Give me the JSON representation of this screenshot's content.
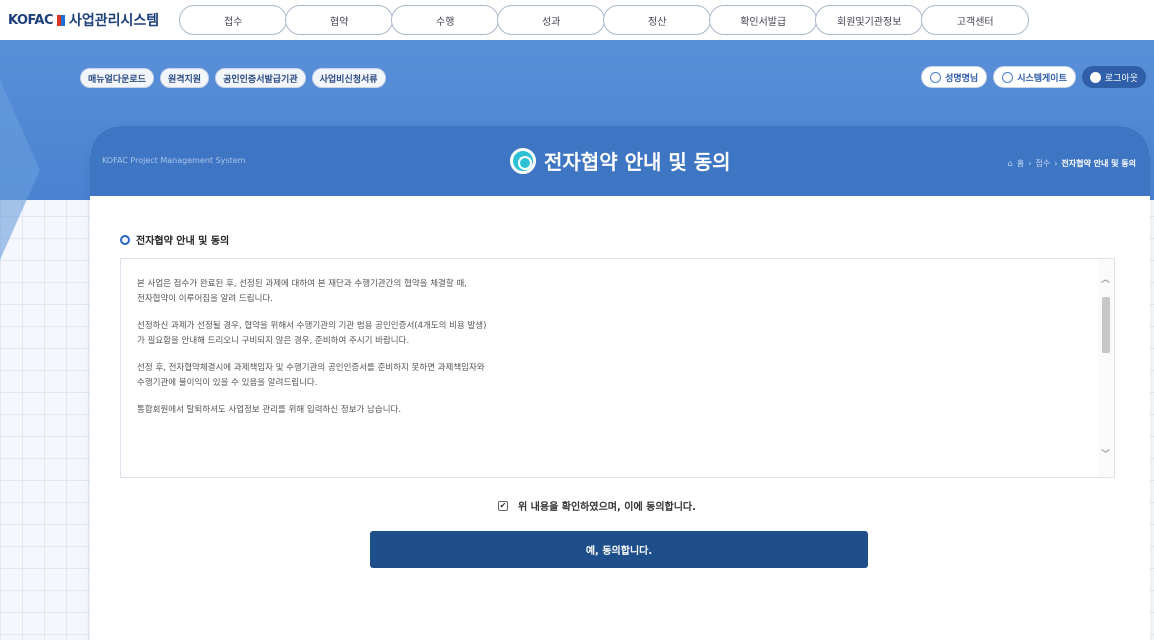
{
  "brand": {
    "logo_text": "KOFAC",
    "system_name": "사업관리시스템"
  },
  "main_menu": [
    {
      "label": "접수"
    },
    {
      "label": "협약"
    },
    {
      "label": "수행"
    },
    {
      "label": "성과"
    },
    {
      "label": "정산"
    },
    {
      "label": "확인서발급"
    },
    {
      "label": "회원및기관정보"
    },
    {
      "label": "고객센터"
    }
  ],
  "sub_menu": [
    {
      "label": "매뉴얼다운로드"
    },
    {
      "label": "원격지원"
    },
    {
      "label": "공인인증서발급기관"
    },
    {
      "label": "사업비신청서류"
    }
  ],
  "user_menu": {
    "user_name": "성명명님",
    "site_map": "시스템게이트",
    "logout": "로그아웃"
  },
  "page": {
    "subtitle": "KOFAC Project Management System",
    "title": "전자협약 안내 및 동의",
    "breadcrumb": [
      "홈",
      "접수",
      "전자협약 안내 및 동의"
    ]
  },
  "section": {
    "title": "전자협약 안내 및 동의",
    "paragraphs": [
      "본 사업은 접수가 완료된 후, 선정된 과제에 대하여 본 재단과 수행기관간의 협약을 체결할 때,\n전자협약이 이루어짐을 알려 드립니다.",
      "선정하신 과제가 선정될 경우, 협약을 위해서 수행기관의 기관 범용 공인인증서(4개도의 비용 발생)\n가 필요함을 안내해 드리오니 구비되지 않은 경우, 준비하여 주시기 바랍니다.",
      "선정 후, 전자협약체결시에 과제책임자 및 수행기관의 공인인증서를 준비하지 못하면 과제책임자와\n수행기관에 불이익이 있을 수 있음을 알려드립니다.",
      "통합회원에서 탈퇴하셔도 사업정보 관리를 위해 입력하신 정보가 남습니다."
    ]
  },
  "agree": {
    "checkbox_label": "위 내용을 확인하였으며, 이에 동의합니다.",
    "checked": true,
    "button_label": "예, 동의합니다."
  },
  "colors": {
    "primary": "#1f4f8a",
    "header_blue": "#3f76c4",
    "band_blue": "#5a90d8",
    "accent_cyan": "#2ec1d6"
  }
}
